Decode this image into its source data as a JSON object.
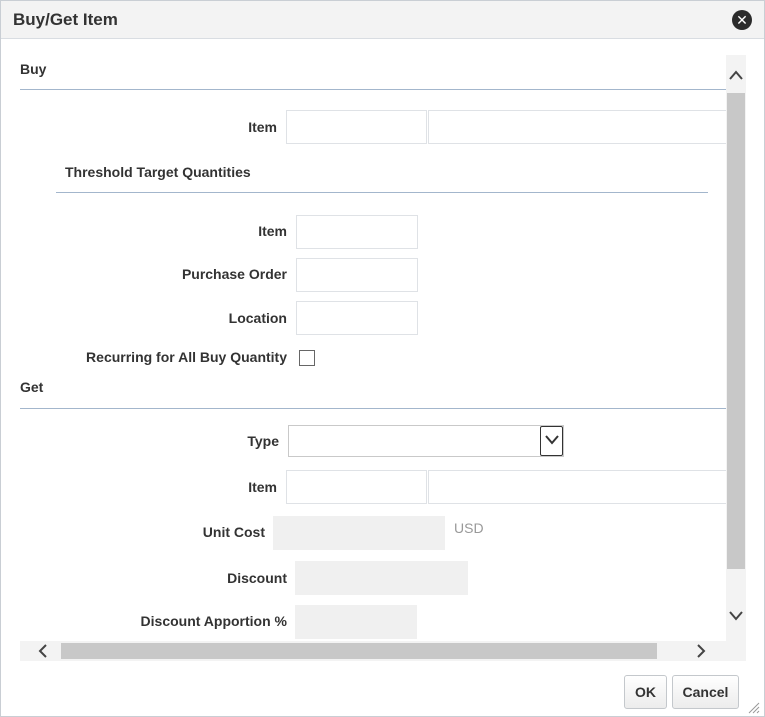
{
  "dialog": {
    "title": "Buy/Get Item"
  },
  "buy": {
    "header": "Buy",
    "item_label": "Item",
    "item_code": "",
    "item_desc": "",
    "threshold": {
      "header": "Threshold Target Quantities",
      "item_label": "Item",
      "item_value": "",
      "po_label": "Purchase Order",
      "po_value": "",
      "location_label": "Location",
      "location_value": ""
    },
    "recurring_label": "Recurring for All Buy Quantity",
    "recurring_checked": false
  },
  "get": {
    "header": "Get",
    "type_label": "Type",
    "type_value": "",
    "item_label": "Item",
    "item_code": "",
    "item_desc": "",
    "unit_cost_label": "Unit Cost",
    "unit_cost_value": "",
    "currency": "USD",
    "discount_label": "Discount",
    "discount_value": "",
    "apportion_label": "Discount Apportion %",
    "apportion_value": ""
  },
  "footer": {
    "ok_label": "OK",
    "cancel_label": "Cancel"
  },
  "icons": {
    "close": "close-circle-icon",
    "dropdown": "chevron-down-icon",
    "scroll_up": "chevron-up-icon",
    "scroll_down": "chevron-down-icon",
    "scroll_left": "chevron-left-icon",
    "scroll_right": "chevron-right-icon",
    "resize": "resize-grip-icon"
  },
  "colors": {
    "divider": "#a3b6cc",
    "readonly_bg": "#f0f0f0",
    "scroll_thumb": "#c8c8c8"
  }
}
